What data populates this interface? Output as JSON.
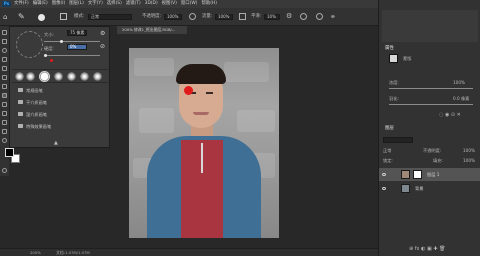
{
  "app": {
    "logo": "Ps"
  },
  "menu": [
    "文件(F)",
    "编辑(E)",
    "图像(I)",
    "图层(L)",
    "文字(Y)",
    "选择(S)",
    "滤镜(T)",
    "3D(D)",
    "视图(V)",
    "窗口(W)",
    "帮助(H)"
  ],
  "options": {
    "mode_label": "模式:",
    "mode_value": "正常",
    "opacity_label": "不透明度:",
    "opacity_value": "100%",
    "flow_label": "流量:",
    "flow_value": "100%",
    "smooth_label": "平滑:",
    "smooth_value": "10%"
  },
  "brush_panel": {
    "size_label": "大小:",
    "size_value": "75 像素",
    "hardness_label": "硬度:",
    "hardness_value": "0%",
    "groups": [
      "常规画笔",
      "干介质画笔",
      "湿介质画笔",
      "特殊效果画笔"
    ]
  },
  "document": {
    "tab_title": "200% 修改1_抠出图层,RGB/..."
  },
  "status": {
    "zoom": "200%",
    "doc_info": "文档:1.07M/1.07M"
  },
  "properties": {
    "title": "属性",
    "kind": "蒙版",
    "density_label": "浓度:",
    "density_value": "100%",
    "feather_label": "羽化:",
    "feather_value": "0.0 像素"
  },
  "layers": {
    "title": "图层",
    "blend_mode": "正常",
    "opacity_label": "不透明度:",
    "opacity_value": "100%",
    "fill_label": "填充:",
    "fill_value": "100%",
    "lock_label": "锁定:",
    "items": [
      {
        "name": "图层 1"
      },
      {
        "name": "背景"
      }
    ]
  },
  "colors": {
    "accent": "#31a8ff",
    "mark": "#e01b1b"
  }
}
